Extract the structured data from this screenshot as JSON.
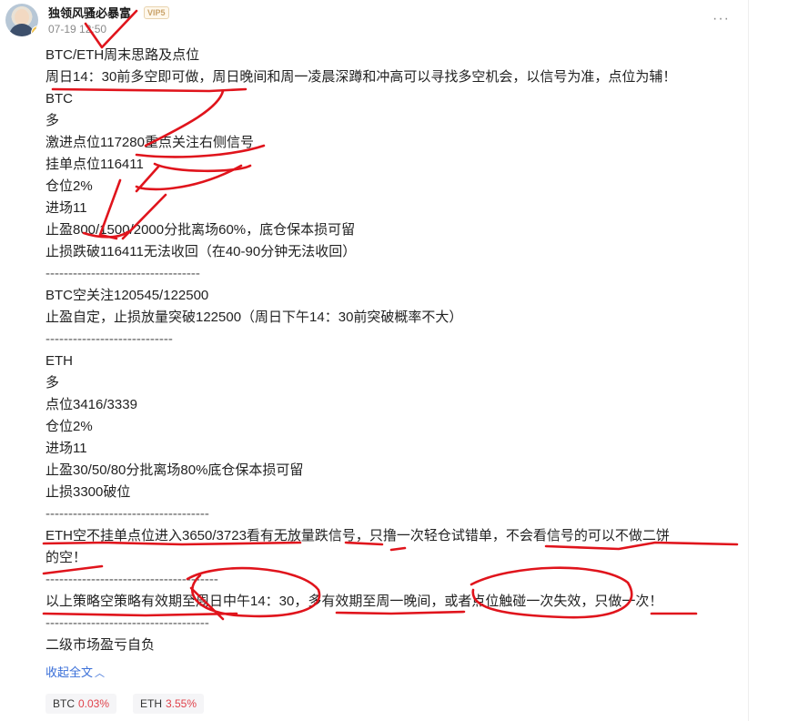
{
  "post": {
    "username": "独领风骚必暴富",
    "vip_badge": "VIP5",
    "time": "07-19 12:50",
    "avatar_badge": "V",
    "more_icon": "more-dots-icon",
    "lines": [
      "BTC/ETH周末思路及点位",
      "周日14：30前多空即可做，周日晚间和周一凌晨深蹲和冲高可以寻找多空机会，以信号为准，点位为辅！",
      "BTC",
      "多",
      "激进点位117280重点关注右侧信号",
      "挂单点位116411",
      "仓位2%",
      "进场11",
      "止盈800/1500/2000分批离场60%，底仓保本损可留",
      "止损跌破116411无法收回（在40-90分钟无法收回）",
      "----------------------------------",
      "BTC空关注120545/122500",
      "止盈自定，止损放量突破122500（周日下午14：30前突破概率不大）",
      "----------------------------",
      "ETH",
      "多",
      "点位3416/3339",
      "仓位2%",
      "进场11",
      "止盈30/50/80分批离场80%底仓保本损可留",
      "止损3300破位",
      "------------------------------------",
      "ETH空不挂单点位进入3650/3723看有无放量跌信号，只撸一次轻仓试错单，不会看信号的可以不做二饼",
      "的空！",
      "--------------------------------------",
      "以上策略空策略有效期至周日中午14：30，多有效期至周一晚间，或者点位触碰一次失效，只做一次！",
      "------------------------------------",
      "二级市场盈亏自负"
    ],
    "expand_label": "收起全文",
    "expand_icon": "chevron-up-icon"
  },
  "tickers": [
    {
      "symbol": "BTC",
      "change": "0.03%"
    },
    {
      "symbol": "ETH",
      "change": "3.55%"
    }
  ],
  "colors": {
    "accent_link": "#3a6fd8",
    "up_red": "#e0424b",
    "annotation_red": "#e0141c"
  }
}
